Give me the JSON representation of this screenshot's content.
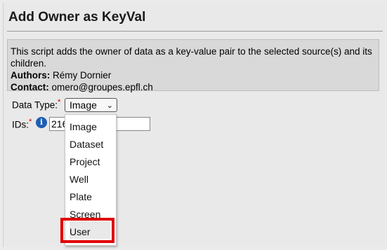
{
  "header": {
    "title": "Add Owner as KeyVal"
  },
  "description": {
    "text": "This script adds the owner of data as a key-value pair to the selected source(s) and its children.",
    "authors_label": "Authors:",
    "authors_value": " Rémy Dornier",
    "contact_label": "Contact:",
    "contact_value": " omero@groupes.epfl.ch"
  },
  "form": {
    "data_type_label": "Data Type:",
    "required_marker": "*",
    "data_type_selected": "Image",
    "ids_label": "IDs:",
    "ids_value": "216",
    "info_icon_glyph": "i"
  },
  "dropdown": {
    "options": [
      "Image",
      "Dataset",
      "Project",
      "Well",
      "Plate",
      "Screen",
      "User"
    ],
    "highlighted": "User"
  },
  "colors": {
    "highlight_border": "#e00000",
    "required": "#cc0000",
    "info_icon": "#1d5fb5"
  }
}
